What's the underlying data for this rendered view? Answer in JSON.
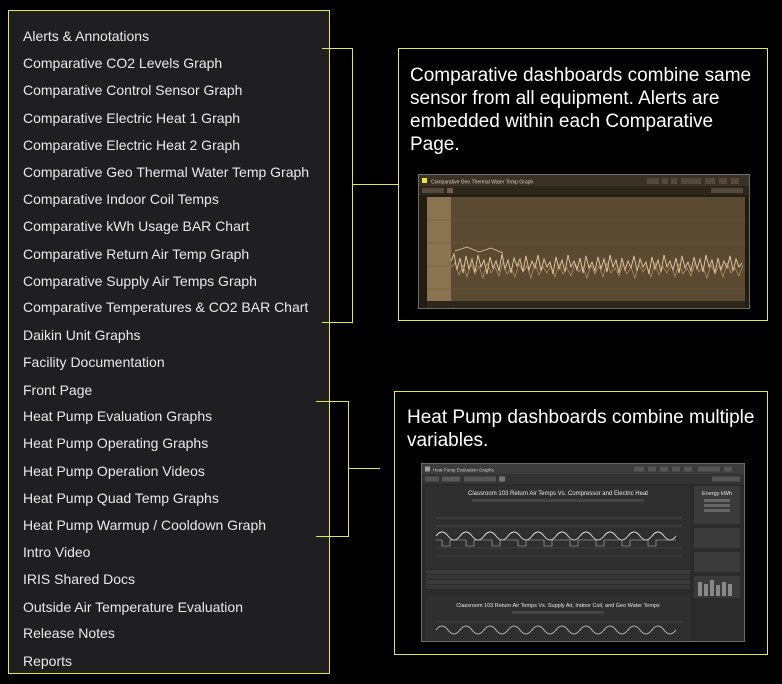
{
  "menu": {
    "items": [
      "Alerts & Annotations",
      "Comparative CO2 Levels Graph",
      "Comparative Control Sensor Graph",
      "Comparative Electric Heat 1 Graph",
      "Comparative Electric Heat 2 Graph",
      "Comparative Geo Thermal Water Temp Graph",
      "Comparative Indoor Coil Temps",
      "Comparative kWh Usage BAR Chart",
      "Comparative Return Air Temp Graph",
      "Comparative Supply Air Temps Graph",
      "Comparative Temperatures & CO2 BAR Chart",
      "Daikin Unit Graphs",
      "Facility Documentation",
      "Front Page",
      "Heat Pump Evaluation Graphs",
      "Heat Pump Operating Graphs",
      "Heat Pump Operation Videos",
      "Heat Pump Quad Temp Graphs",
      "Heat Pump Warmup / Cooldown Graph",
      "Intro Video",
      "IRIS Shared Docs",
      "Outside Air Temperature Evaluation",
      "Release Notes",
      "Reports"
    ]
  },
  "callouts": {
    "comparative": {
      "text": "Comparative dashboards combine same sensor from all equipment. Alerts are embedded within each Comparative Page.",
      "thumbnail_title": "Comparative Geo Thermal Water Temp Graph"
    },
    "heat_pump": {
      "text": "Heat Pump dashboards combine multiple variables.",
      "thumbnail_title": "Heat Pump Evaluation Graphs",
      "panel_title_1": "Classroom 103 Return Air Temps Vs. Compressor and Electric Heat",
      "panel_title_2": "Classroom 103 Return Air Temps Vs. Supply Air, Indoor Coil, and Geo Water Temps",
      "side_panel_title": "Energy kWh"
    }
  },
  "colors": {
    "accent": "#e8e83a",
    "menu_bg": "#1f1f21",
    "menu_text": "#e9e9e9",
    "chart_bg": "#5a4a32",
    "chart_line": "#e8c9a0"
  }
}
